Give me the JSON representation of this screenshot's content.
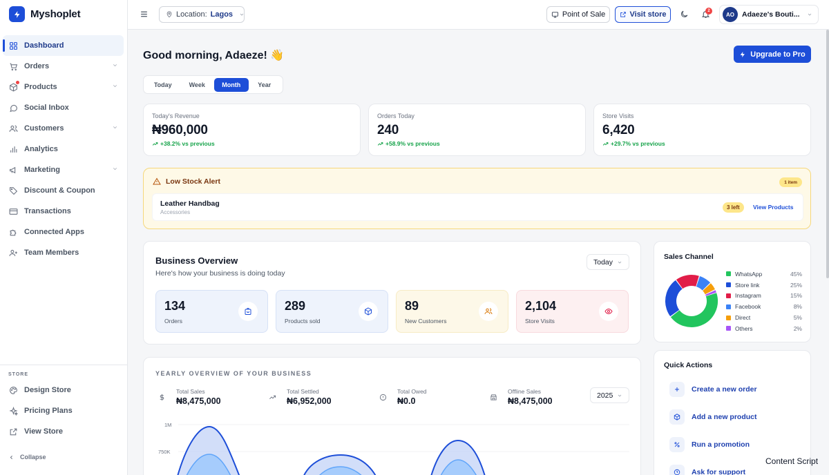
{
  "app": {
    "name": "Myshoplet"
  },
  "sidebar": {
    "items": [
      {
        "label": "Dashboard",
        "icon": "grid-icon",
        "active": true
      },
      {
        "label": "Orders",
        "icon": "cart-icon",
        "chevron": true
      },
      {
        "label": "Products",
        "icon": "box-icon",
        "chevron": true,
        "dot": true
      },
      {
        "label": "Social Inbox",
        "icon": "chat-icon"
      },
      {
        "label": "Customers",
        "icon": "users-icon",
        "chevron": true
      },
      {
        "label": "Analytics",
        "icon": "bar-chart-icon"
      },
      {
        "label": "Marketing",
        "icon": "megaphone-icon",
        "chevron": true
      },
      {
        "label": "Discount & Coupon",
        "icon": "tag-icon"
      },
      {
        "label": "Transactions",
        "icon": "card-icon"
      },
      {
        "label": "Connected Apps",
        "icon": "puzzle-icon"
      },
      {
        "label": "Team Members",
        "icon": "user-plus-icon"
      }
    ],
    "store_label": "STORE",
    "store_items": [
      {
        "label": "Design Store",
        "icon": "palette-icon"
      },
      {
        "label": "Pricing Plans",
        "icon": "sparkle-icon"
      },
      {
        "label": "View Store",
        "icon": "external-link-icon"
      }
    ],
    "collapse_label": "Collapse"
  },
  "topbar": {
    "location_prefix": "Location:",
    "location_value": "Lagos",
    "pos_label": "Point of Sale",
    "visit_label": "Visit store",
    "notification_count": "2",
    "avatar_initials": "AO",
    "account_name": "Adaeze's Bouti..."
  },
  "greeting": "Good morning, Adaeze! 👋",
  "upgrade_label": "Upgrade to Pro",
  "period_tabs": [
    {
      "label": "Today",
      "active": false
    },
    {
      "label": "Week",
      "active": false
    },
    {
      "label": "Month",
      "active": true
    },
    {
      "label": "Year",
      "active": false
    }
  ],
  "stats": [
    {
      "label": "Today's Revenue",
      "value": "₦960,000",
      "change": "+38.2% vs previous"
    },
    {
      "label": "Orders Today",
      "value": "240",
      "change": "+58.9% vs previous"
    },
    {
      "label": "Store Visits",
      "value": "6,420",
      "change": "+29.7% vs previous"
    }
  ],
  "alert": {
    "title": "Low Stock Alert",
    "count": "1 item",
    "item_name": "Leather Handbag",
    "item_category": "Accessories",
    "item_left": "3 left",
    "view_label": "View Products"
  },
  "overview": {
    "title": "Business Overview",
    "subtitle": "Here's how your business is doing today",
    "period": "Today",
    "cards": [
      {
        "value": "134",
        "label": "Orders",
        "icon": "bag-icon",
        "bg": "#eef3fc",
        "color": "#1d4ed8"
      },
      {
        "value": "289",
        "label": "Products sold",
        "icon": "cube-icon",
        "bg": "#eef3fc",
        "color": "#1d4ed8"
      },
      {
        "value": "89",
        "label": "New Customers",
        "icon": "users-icon",
        "bg": "#fdf8e8",
        "color": "#d97706"
      },
      {
        "value": "2,104",
        "label": "Store Visits",
        "icon": "eye-icon",
        "bg": "#fdf0f1",
        "color": "#e11d48"
      }
    ]
  },
  "sales_channel": {
    "title": "Sales Channel",
    "channels": [
      {
        "name": "WhatsApp",
        "pct": "45%",
        "value": 45,
        "color": "#22c55e"
      },
      {
        "name": "Store link",
        "pct": "25%",
        "value": 25,
        "color": "#1d4ed8"
      },
      {
        "name": "Instagram",
        "pct": "15%",
        "value": 15,
        "color": "#e11d48"
      },
      {
        "name": "Facebook",
        "pct": "8%",
        "value": 8,
        "color": "#3b82f6"
      },
      {
        "name": "Direct",
        "pct": "5%",
        "value": 5,
        "color": "#f59e0b"
      },
      {
        "name": "Others",
        "pct": "2%",
        "value": 2,
        "color": "#a855f7"
      }
    ]
  },
  "yearly": {
    "title": "YEARLY OVERVIEW OF YOUR BUSINESS",
    "year": "2025",
    "stats": [
      {
        "label": "Total Sales",
        "value": "₦8,475,000",
        "icon": "dollar-icon"
      },
      {
        "label": "Total Settled",
        "value": "₦6,952,000",
        "icon": "trend-icon"
      },
      {
        "label": "Total Owed",
        "value": "₦0.0",
        "icon": "info-icon"
      },
      {
        "label": "Offline Sales",
        "value": "₦8,475,000",
        "icon": "store-icon"
      }
    ],
    "y_ticks": [
      "1M",
      "750K"
    ]
  },
  "quick_actions": {
    "title": "Quick Actions",
    "items": [
      {
        "label": "Create a new order",
        "icon": "plus-icon"
      },
      {
        "label": "Add a new product",
        "icon": "cube-icon"
      },
      {
        "label": "Run a promotion",
        "icon": "percent-icon"
      },
      {
        "label": "Ask for support",
        "icon": "help-icon"
      }
    ]
  },
  "footer_text": "Content Script",
  "accent": "#1d4ed8"
}
